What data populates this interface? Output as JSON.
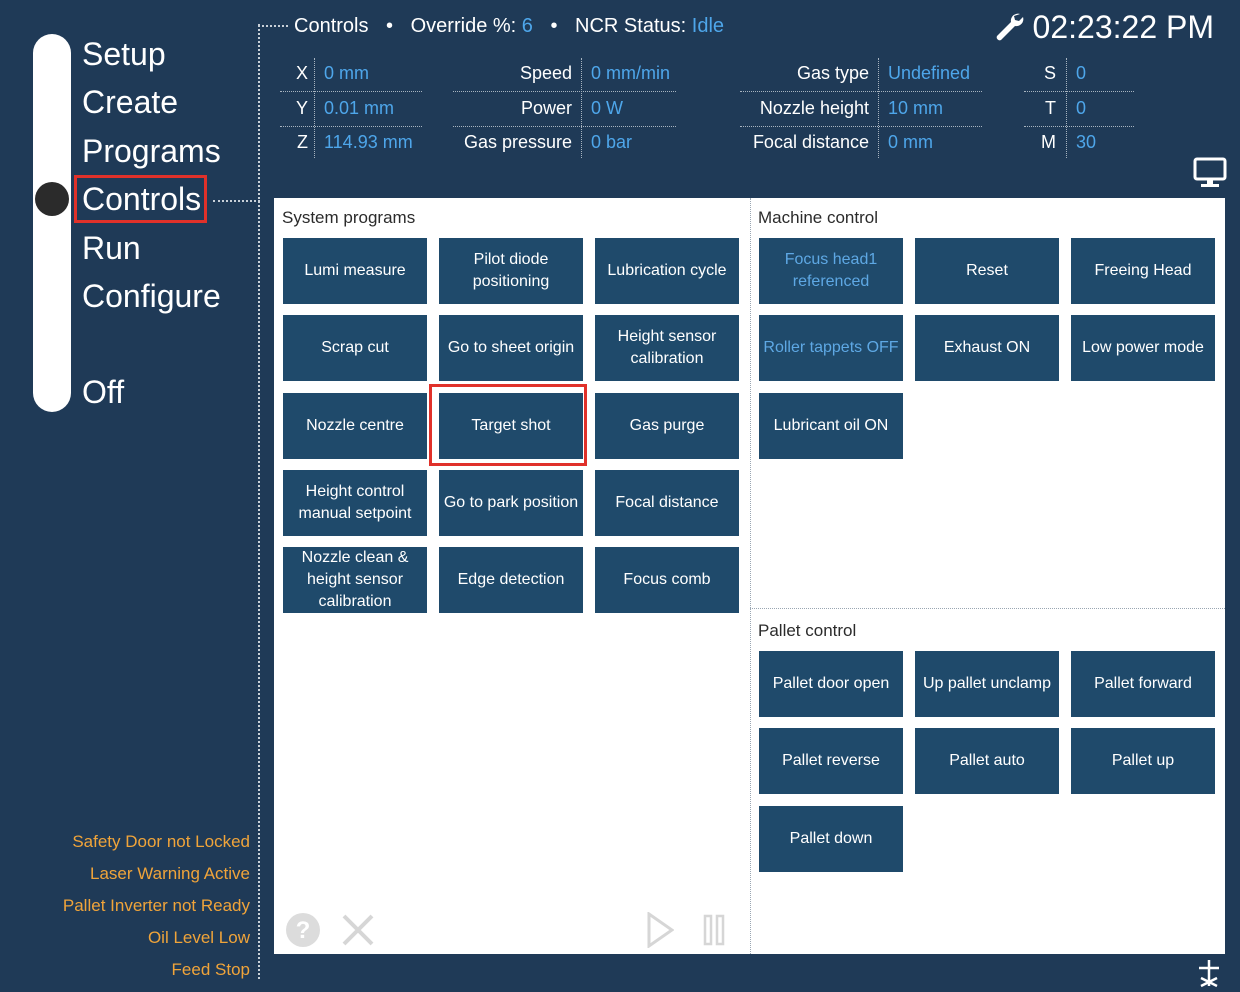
{
  "nav": {
    "items": [
      {
        "label": "Setup"
      },
      {
        "label": "Create"
      },
      {
        "label": "Programs"
      },
      {
        "label": "Controls"
      },
      {
        "label": "Run"
      },
      {
        "label": "Configure"
      },
      {
        "label": "Off"
      }
    ],
    "active": "Controls"
  },
  "header": {
    "section": "Controls",
    "override_label": "Override %:",
    "override_value": "6",
    "ncr_label": "NCR Status:",
    "ncr_value": "Idle",
    "clock": "02:23:22 PM"
  },
  "params": {
    "x_label": "X",
    "x_value": "0 mm",
    "y_label": "Y",
    "y_value": "0.01 mm",
    "z_label": "Z",
    "z_value": "114.93 mm",
    "speed_label": "Speed",
    "speed_value": "0 mm/min",
    "power_label": "Power",
    "power_value": "0 W",
    "gas_pressure_label": "Gas pressure",
    "gas_pressure_value": "0 bar",
    "gas_type_label": "Gas type",
    "gas_type_value": "Undefined",
    "nozzle_height_label": "Nozzle height",
    "nozzle_height_value": "10 mm",
    "focal_distance_label": "Focal distance",
    "focal_distance_value": "0 mm",
    "s_label": "S",
    "s_value": "0",
    "t_label": "T",
    "t_value": "0",
    "m_label": "M",
    "m_value": "30"
  },
  "system_programs": {
    "title": "System programs",
    "buttons": [
      {
        "label": "Lumi measure"
      },
      {
        "label": "Pilot diode positioning"
      },
      {
        "label": "Lubrication cycle"
      },
      {
        "label": "Scrap cut"
      },
      {
        "label": "Go to sheet origin"
      },
      {
        "label": "Height sensor calibration"
      },
      {
        "label": "Nozzle centre"
      },
      {
        "label": "Target shot"
      },
      {
        "label": "Gas purge"
      },
      {
        "label": "Height control manual setpoint"
      },
      {
        "label": "Go to park position"
      },
      {
        "label": "Focal distance"
      },
      {
        "label": "Nozzle clean & height sensor calibration"
      },
      {
        "label": "Edge detection"
      },
      {
        "label": "Focus comb"
      }
    ]
  },
  "machine_control": {
    "title": "Machine control",
    "buttons": [
      {
        "label": "Focus head1 referenced"
      },
      {
        "label": "Reset"
      },
      {
        "label": "Freeing Head"
      },
      {
        "label": "Roller tappets OFF"
      },
      {
        "label": "Exhaust ON"
      },
      {
        "label": "Low power mode"
      },
      {
        "label": "Lubricant oil ON"
      }
    ]
  },
  "pallet_control": {
    "title": "Pallet control",
    "buttons": [
      {
        "label": "Pallet door open"
      },
      {
        "label": "Up pallet unclamp"
      },
      {
        "label": "Pallet forward"
      },
      {
        "label": "Pallet reverse"
      },
      {
        "label": "Pallet auto"
      },
      {
        "label": "Pallet up"
      },
      {
        "label": "Pallet down"
      }
    ]
  },
  "warnings": [
    "Safety Door not Locked",
    "Laser Warning Active",
    "Pallet Inverter not Ready",
    "Oil Level Low",
    "Feed Stop"
  ],
  "colors": {
    "background": "#1f3a57",
    "button": "#1f4a6b",
    "value_blue": "#4ea6ea",
    "warning": "#f0a43a",
    "highlight": "#e0312a"
  },
  "icons": [
    "wrench-icon",
    "monitor-icon",
    "help-icon",
    "cancel-icon",
    "play-icon",
    "pause-icon",
    "tool-corner-icon"
  ]
}
